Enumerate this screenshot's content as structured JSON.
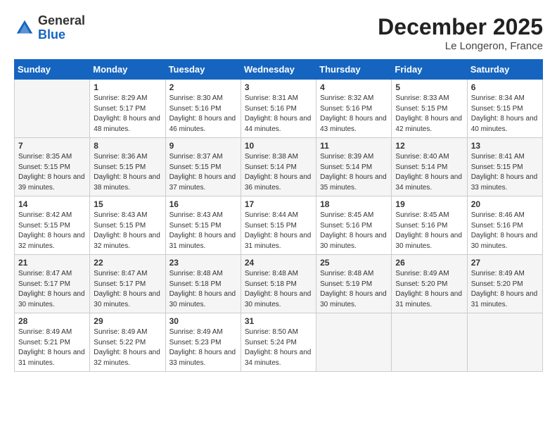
{
  "header": {
    "logo_general": "General",
    "logo_blue": "Blue",
    "month": "December 2025",
    "location": "Le Longeron, France"
  },
  "days_of_week": [
    "Sunday",
    "Monday",
    "Tuesday",
    "Wednesday",
    "Thursday",
    "Friday",
    "Saturday"
  ],
  "weeks": [
    [
      {
        "num": "",
        "empty": true
      },
      {
        "num": "1",
        "sunrise": "Sunrise: 8:29 AM",
        "sunset": "Sunset: 5:17 PM",
        "daylight": "Daylight: 8 hours and 48 minutes."
      },
      {
        "num": "2",
        "sunrise": "Sunrise: 8:30 AM",
        "sunset": "Sunset: 5:16 PM",
        "daylight": "Daylight: 8 hours and 46 minutes."
      },
      {
        "num": "3",
        "sunrise": "Sunrise: 8:31 AM",
        "sunset": "Sunset: 5:16 PM",
        "daylight": "Daylight: 8 hours and 44 minutes."
      },
      {
        "num": "4",
        "sunrise": "Sunrise: 8:32 AM",
        "sunset": "Sunset: 5:16 PM",
        "daylight": "Daylight: 8 hours and 43 minutes."
      },
      {
        "num": "5",
        "sunrise": "Sunrise: 8:33 AM",
        "sunset": "Sunset: 5:15 PM",
        "daylight": "Daylight: 8 hours and 42 minutes."
      },
      {
        "num": "6",
        "sunrise": "Sunrise: 8:34 AM",
        "sunset": "Sunset: 5:15 PM",
        "daylight": "Daylight: 8 hours and 40 minutes."
      }
    ],
    [
      {
        "num": "7",
        "sunrise": "Sunrise: 8:35 AM",
        "sunset": "Sunset: 5:15 PM",
        "daylight": "Daylight: 8 hours and 39 minutes."
      },
      {
        "num": "8",
        "sunrise": "Sunrise: 8:36 AM",
        "sunset": "Sunset: 5:15 PM",
        "daylight": "Daylight: 8 hours and 38 minutes."
      },
      {
        "num": "9",
        "sunrise": "Sunrise: 8:37 AM",
        "sunset": "Sunset: 5:15 PM",
        "daylight": "Daylight: 8 hours and 37 minutes."
      },
      {
        "num": "10",
        "sunrise": "Sunrise: 8:38 AM",
        "sunset": "Sunset: 5:14 PM",
        "daylight": "Daylight: 8 hours and 36 minutes."
      },
      {
        "num": "11",
        "sunrise": "Sunrise: 8:39 AM",
        "sunset": "Sunset: 5:14 PM",
        "daylight": "Daylight: 8 hours and 35 minutes."
      },
      {
        "num": "12",
        "sunrise": "Sunrise: 8:40 AM",
        "sunset": "Sunset: 5:14 PM",
        "daylight": "Daylight: 8 hours and 34 minutes."
      },
      {
        "num": "13",
        "sunrise": "Sunrise: 8:41 AM",
        "sunset": "Sunset: 5:15 PM",
        "daylight": "Daylight: 8 hours and 33 minutes."
      }
    ],
    [
      {
        "num": "14",
        "sunrise": "Sunrise: 8:42 AM",
        "sunset": "Sunset: 5:15 PM",
        "daylight": "Daylight: 8 hours and 32 minutes."
      },
      {
        "num": "15",
        "sunrise": "Sunrise: 8:43 AM",
        "sunset": "Sunset: 5:15 PM",
        "daylight": "Daylight: 8 hours and 32 minutes."
      },
      {
        "num": "16",
        "sunrise": "Sunrise: 8:43 AM",
        "sunset": "Sunset: 5:15 PM",
        "daylight": "Daylight: 8 hours and 31 minutes."
      },
      {
        "num": "17",
        "sunrise": "Sunrise: 8:44 AM",
        "sunset": "Sunset: 5:15 PM",
        "daylight": "Daylight: 8 hours and 31 minutes."
      },
      {
        "num": "18",
        "sunrise": "Sunrise: 8:45 AM",
        "sunset": "Sunset: 5:16 PM",
        "daylight": "Daylight: 8 hours and 30 minutes."
      },
      {
        "num": "19",
        "sunrise": "Sunrise: 8:45 AM",
        "sunset": "Sunset: 5:16 PM",
        "daylight": "Daylight: 8 hours and 30 minutes."
      },
      {
        "num": "20",
        "sunrise": "Sunrise: 8:46 AM",
        "sunset": "Sunset: 5:16 PM",
        "daylight": "Daylight: 8 hours and 30 minutes."
      }
    ],
    [
      {
        "num": "21",
        "sunrise": "Sunrise: 8:47 AM",
        "sunset": "Sunset: 5:17 PM",
        "daylight": "Daylight: 8 hours and 30 minutes."
      },
      {
        "num": "22",
        "sunrise": "Sunrise: 8:47 AM",
        "sunset": "Sunset: 5:17 PM",
        "daylight": "Daylight: 8 hours and 30 minutes."
      },
      {
        "num": "23",
        "sunrise": "Sunrise: 8:48 AM",
        "sunset": "Sunset: 5:18 PM",
        "daylight": "Daylight: 8 hours and 30 minutes."
      },
      {
        "num": "24",
        "sunrise": "Sunrise: 8:48 AM",
        "sunset": "Sunset: 5:18 PM",
        "daylight": "Daylight: 8 hours and 30 minutes."
      },
      {
        "num": "25",
        "sunrise": "Sunrise: 8:48 AM",
        "sunset": "Sunset: 5:19 PM",
        "daylight": "Daylight: 8 hours and 30 minutes."
      },
      {
        "num": "26",
        "sunrise": "Sunrise: 8:49 AM",
        "sunset": "Sunset: 5:20 PM",
        "daylight": "Daylight: 8 hours and 31 minutes."
      },
      {
        "num": "27",
        "sunrise": "Sunrise: 8:49 AM",
        "sunset": "Sunset: 5:20 PM",
        "daylight": "Daylight: 8 hours and 31 minutes."
      }
    ],
    [
      {
        "num": "28",
        "sunrise": "Sunrise: 8:49 AM",
        "sunset": "Sunset: 5:21 PM",
        "daylight": "Daylight: 8 hours and 31 minutes."
      },
      {
        "num": "29",
        "sunrise": "Sunrise: 8:49 AM",
        "sunset": "Sunset: 5:22 PM",
        "daylight": "Daylight: 8 hours and 32 minutes."
      },
      {
        "num": "30",
        "sunrise": "Sunrise: 8:49 AM",
        "sunset": "Sunset: 5:23 PM",
        "daylight": "Daylight: 8 hours and 33 minutes."
      },
      {
        "num": "31",
        "sunrise": "Sunrise: 8:50 AM",
        "sunset": "Sunset: 5:24 PM",
        "daylight": "Daylight: 8 hours and 34 minutes."
      },
      {
        "num": "",
        "empty": true
      },
      {
        "num": "",
        "empty": true
      },
      {
        "num": "",
        "empty": true
      }
    ]
  ]
}
